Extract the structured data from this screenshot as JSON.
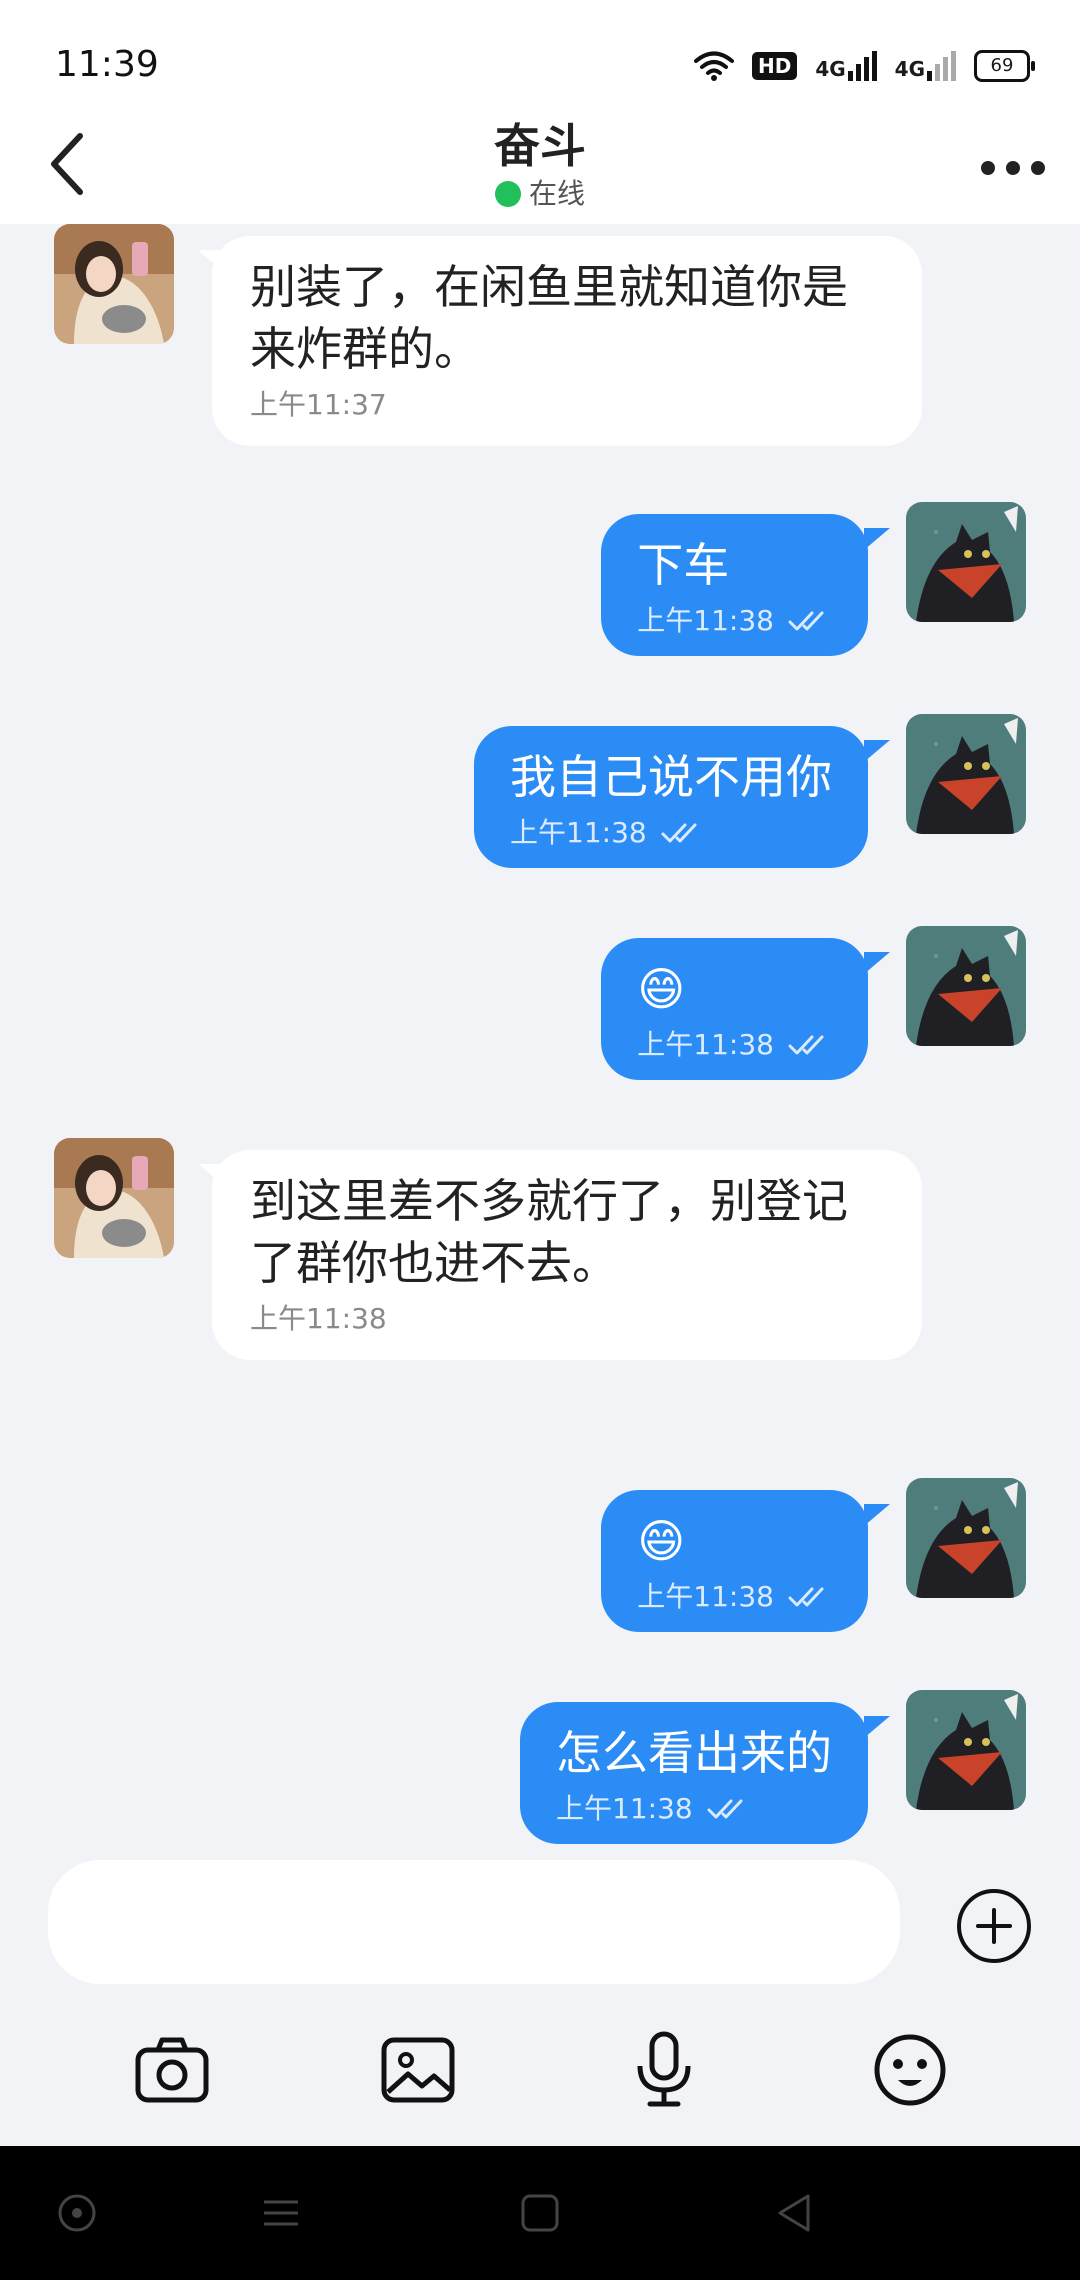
{
  "status_bar": {
    "time": "11:39",
    "hd": "HD",
    "network1": "4G",
    "network2": "4G",
    "battery": "69"
  },
  "header": {
    "title": "奋斗",
    "presence": "在线"
  },
  "messages": [
    {
      "side": "in",
      "text": "别装了，在闲鱼里就知道你是来炸群的。",
      "time": "上午11:37"
    },
    {
      "side": "out",
      "text": "下车",
      "time": "上午11:38"
    },
    {
      "side": "out",
      "text": "我自己说不用你",
      "time": "上午11:38"
    },
    {
      "side": "out",
      "text": "😄",
      "time": "上午11:38"
    },
    {
      "side": "in",
      "text": "到这里差不多就行了，别登记了群你也进不去。",
      "time": "上午11:38"
    },
    {
      "side": "out",
      "text": "😄",
      "time": "上午11:38"
    },
    {
      "side": "out",
      "text": "怎么看出来的",
      "time": "上午11:38"
    }
  ],
  "input": {
    "placeholder": ""
  },
  "icons": {
    "back": "back-arrow-icon",
    "more": "more-dots-icon",
    "plus": "plus-circle-icon",
    "camera": "camera-icon",
    "gallery": "image-icon",
    "mic": "microphone-icon",
    "emoji": "emoji-icon",
    "read": "double-check-icon"
  },
  "colors": {
    "outgoing_bubble": "#2b8cf5",
    "incoming_bubble": "#ffffff",
    "online": "#21c05a"
  }
}
